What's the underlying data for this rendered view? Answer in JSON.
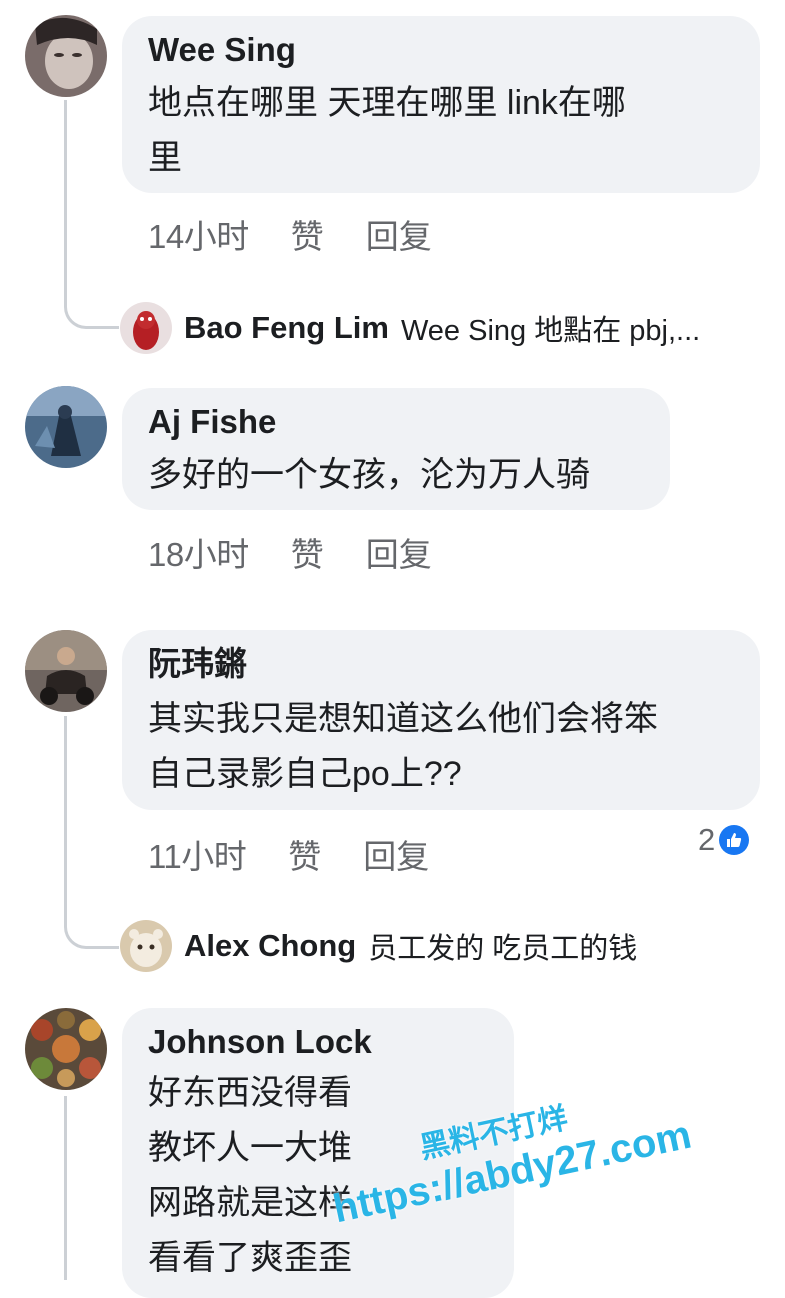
{
  "comments": [
    {
      "author": "Wee Sing",
      "text": "地点在哪里 天理在哪里  link在哪\n里",
      "time": "14小时",
      "like_label": "赞",
      "reply_label": "回复",
      "reply_preview": {
        "author": "Bao Feng Lim",
        "snippet": "Wee Sing 地點在 pbj,..."
      }
    },
    {
      "author": "Aj Fishe",
      "text": "多好的一个女孩，沦为万人骑",
      "time": "18小时",
      "like_label": "赞",
      "reply_label": "回复"
    },
    {
      "author": "阮玮鏘",
      "text": "其实我只是想知道这么他们会将笨\n自己录影自己po上??",
      "time": "11小时",
      "like_label": "赞",
      "reply_label": "回复",
      "reaction_count": "2",
      "reply_preview": {
        "author": "Alex Chong",
        "snippet": "员工发的 吃员工的钱"
      }
    },
    {
      "author": "Johnson Lock",
      "text": "好东西没得看\n教坏人一大堆\n网路就是这样\n看看了爽歪歪"
    }
  ],
  "watermark": {
    "line1": "黑料不打烊",
    "line2": "https://abdy27.com"
  },
  "colors": {
    "bubble": "#f0f2f5",
    "meta": "#65676b",
    "like": "#1877f2",
    "watermark": "#2ab5e6"
  }
}
